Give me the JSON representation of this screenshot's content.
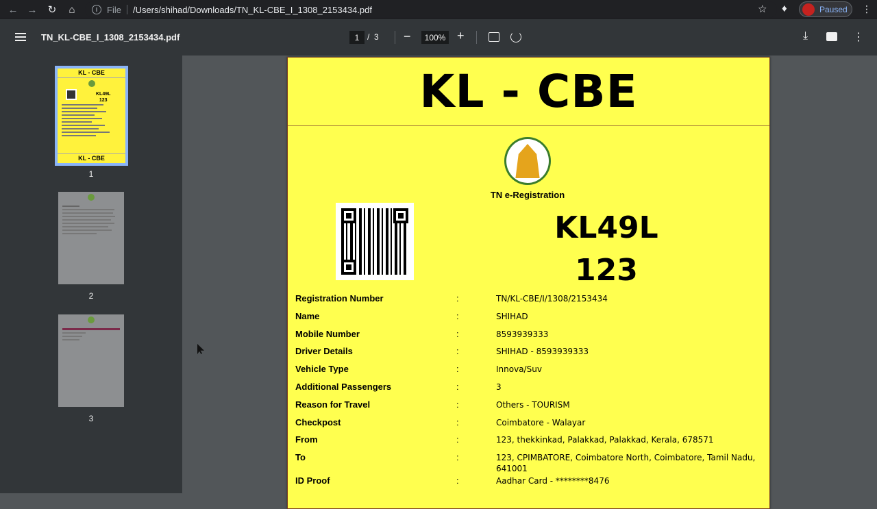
{
  "browser": {
    "url_scheme_label": "File",
    "url": "/Users/shihad/Downloads/TN_KL-CBE_I_1308_2153434.pdf",
    "profile_status": "Paused"
  },
  "pdf_toolbar": {
    "title": "TN_KL-CBE_I_1308_2153434.pdf",
    "current_page": "1",
    "page_separator": "/",
    "total_pages": "3",
    "zoom": "100%"
  },
  "sidebar": {
    "thumbnails": [
      {
        "number": "1",
        "head": "KL - CBE",
        "plate_1": "KL49L",
        "plate_2": "123",
        "foot": "KL - CBE"
      },
      {
        "number": "2"
      },
      {
        "number": "3"
      }
    ]
  },
  "document": {
    "header": "KL - CBE",
    "issuer": "TN e-Registration",
    "plate_line_1": "KL49L",
    "plate_line_2": "123",
    "separator": ":",
    "fields": [
      {
        "label": "Registration Number",
        "value": "TN/KL-CBE/I/1308/2153434"
      },
      {
        "label": "Name",
        "value": "SHIHAD"
      },
      {
        "label": "Mobile Number",
        "value": "8593939333"
      },
      {
        "label": "Driver Details",
        "value": "SHIHAD - 8593939333"
      },
      {
        "label": "Vehicle Type",
        "value": "Innova/Suv"
      },
      {
        "label": "Additional Passengers",
        "value": "3"
      },
      {
        "label": "Reason for Travel",
        "value": "Others - TOURISM"
      },
      {
        "label": "Checkpost",
        "value": "Coimbatore - Walayar"
      },
      {
        "label": "From",
        "value": "123, thekkinkad, Palakkad, Palakkad, Kerala, 678571"
      },
      {
        "label": "To",
        "value": "123, CPIMBATORE, Coimbatore North, Coimbatore, Tamil Nadu, 641001"
      },
      {
        "label": "ID Proof",
        "value": "Aadhar Card - ********8476"
      }
    ]
  },
  "colors": {
    "page_background": "#ffff4f",
    "viewer_background": "#525659",
    "toolbar_background": "#323639",
    "thumbnail_selected_border": "#8ab4f8"
  }
}
